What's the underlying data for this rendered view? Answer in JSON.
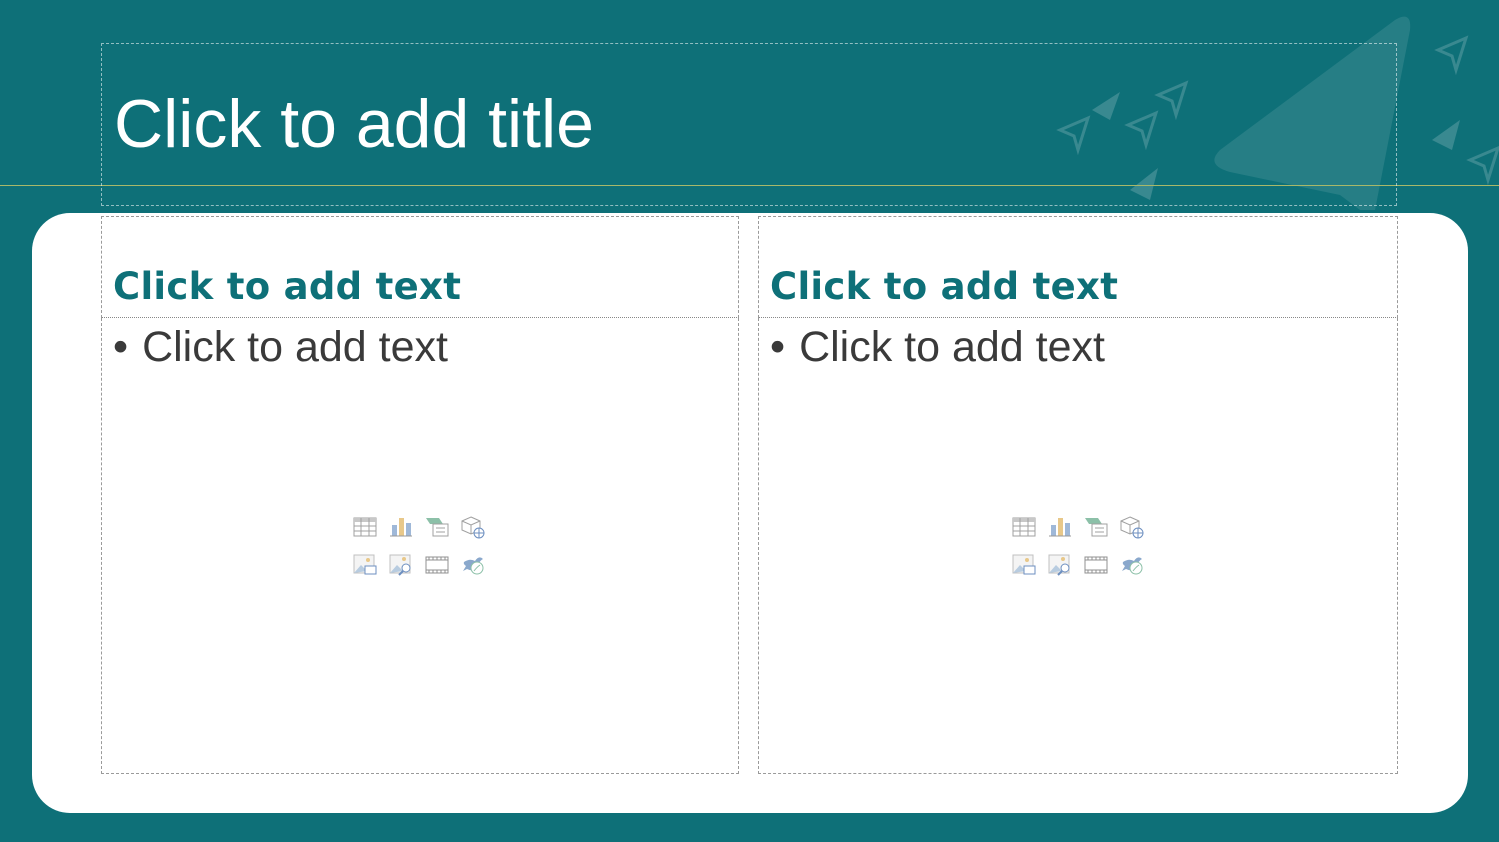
{
  "slide": {
    "title_placeholder": "Click to add title",
    "columns": [
      {
        "header_placeholder": "Click to add text",
        "bullet_char": "•",
        "body_placeholder": "Click to add text",
        "insert_icons": [
          "table-icon",
          "chart-icon",
          "smartart-icon",
          "3d-model-icon",
          "picture-icon",
          "online-picture-icon",
          "video-icon",
          "icons-icon"
        ]
      },
      {
        "header_placeholder": "Click to add text",
        "bullet_char": "•",
        "body_placeholder": "Click to add text",
        "insert_icons": [
          "table-icon",
          "chart-icon",
          "smartart-icon",
          "3d-model-icon",
          "picture-icon",
          "online-picture-icon",
          "video-icon",
          "icons-icon"
        ]
      }
    ]
  },
  "colors": {
    "background": "#0e7078",
    "card": "#ffffff",
    "accent_line": "#a8b86a",
    "header_text": "#0e7078",
    "body_text": "#3a3a3a"
  }
}
